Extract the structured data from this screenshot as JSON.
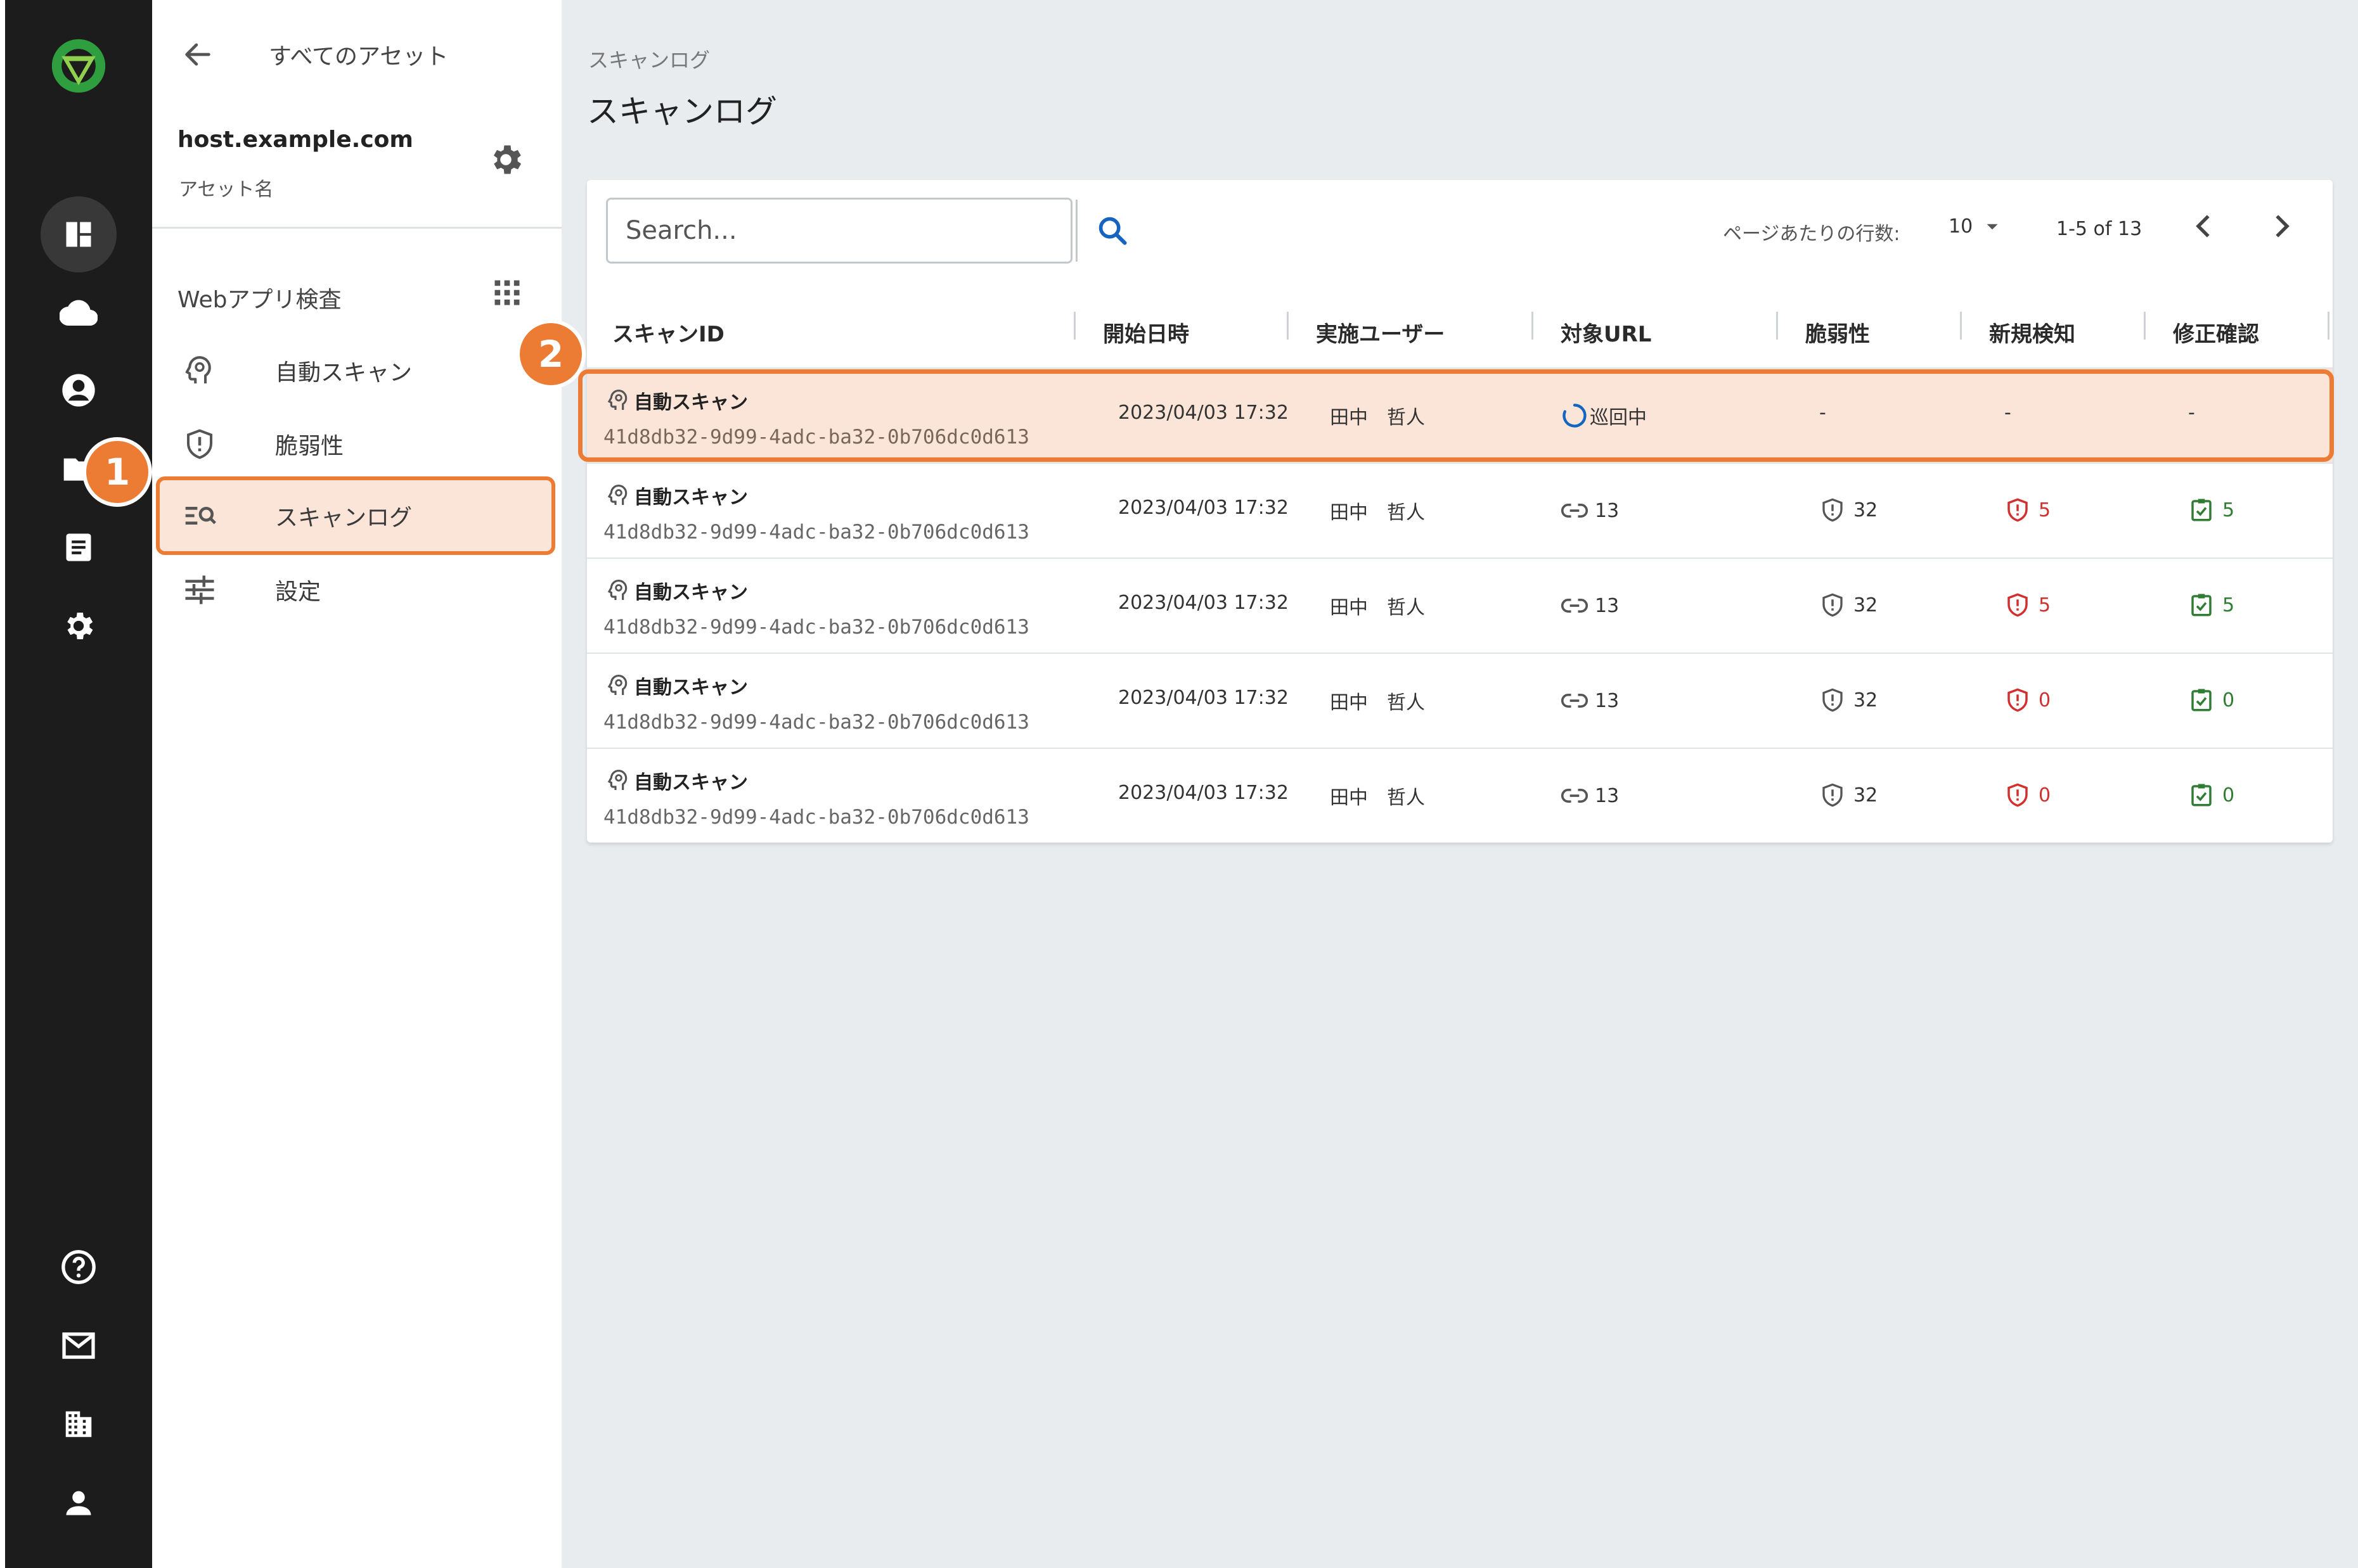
{
  "sidebar": {
    "back_label": "すべてのアセット",
    "asset_host": "host.example.com",
    "asset_label": "アセット名",
    "section_title": "Webアプリ検査",
    "items": [
      {
        "label": "自動スキャン",
        "icon": "auto-scan-icon"
      },
      {
        "label": "脆弱性",
        "icon": "shield-icon"
      },
      {
        "label": "スキャンログ",
        "icon": "scan-log-icon",
        "active": true
      },
      {
        "label": "設定",
        "icon": "sliders-icon"
      }
    ]
  },
  "main": {
    "breadcrumb": "スキャンログ",
    "title": "スキャンログ"
  },
  "table": {
    "search_placeholder": "Search...",
    "rows_per_page_label": "ページあたりの行数:",
    "rows_per_page_value": "10",
    "page_range": "1-5 of 13",
    "columns": [
      "スキャンID",
      "開始日時",
      "実施ユーザー",
      "対象URL",
      "脆弱性",
      "新規検知",
      "修正確認"
    ],
    "rows": [
      {
        "type": "自動スキャン",
        "id": "41d8db32-9d99-4adc-ba32-0b706dc0d613",
        "date": "2023/04/03 17:32",
        "user": "田中　哲人",
        "url": "巡回中",
        "status": "running",
        "vuln": "-",
        "new": "-",
        "fixed": "-"
      },
      {
        "type": "自動スキャン",
        "id": "41d8db32-9d99-4adc-ba32-0b706dc0d613",
        "date": "2023/04/03 17:32",
        "user": "田中　哲人",
        "url": "13",
        "vuln": "32",
        "new": "5",
        "fixed": "5"
      },
      {
        "type": "自動スキャン",
        "id": "41d8db32-9d99-4adc-ba32-0b706dc0d613",
        "date": "2023/04/03 17:32",
        "user": "田中　哲人",
        "url": "13",
        "vuln": "32",
        "new": "5",
        "fixed": "5"
      },
      {
        "type": "自動スキャン",
        "id": "41d8db32-9d99-4adc-ba32-0b706dc0d613",
        "date": "2023/04/03 17:32",
        "user": "田中　哲人",
        "url": "13",
        "vuln": "32",
        "new": "0",
        "fixed": "0"
      },
      {
        "type": "自動スキャン",
        "id": "41d8db32-9d99-4adc-ba32-0b706dc0d613",
        "date": "2023/04/03 17:32",
        "user": "田中　哲人",
        "url": "13",
        "vuln": "32",
        "new": "0",
        "fixed": "0"
      }
    ]
  },
  "annotations": {
    "step1": "1",
    "step2": "2"
  },
  "colors": {
    "accent": "#ec7c34",
    "danger": "#d32f2f",
    "success": "#2e7d32",
    "link": "#1565c0",
    "rail": "#1c1c1c"
  }
}
